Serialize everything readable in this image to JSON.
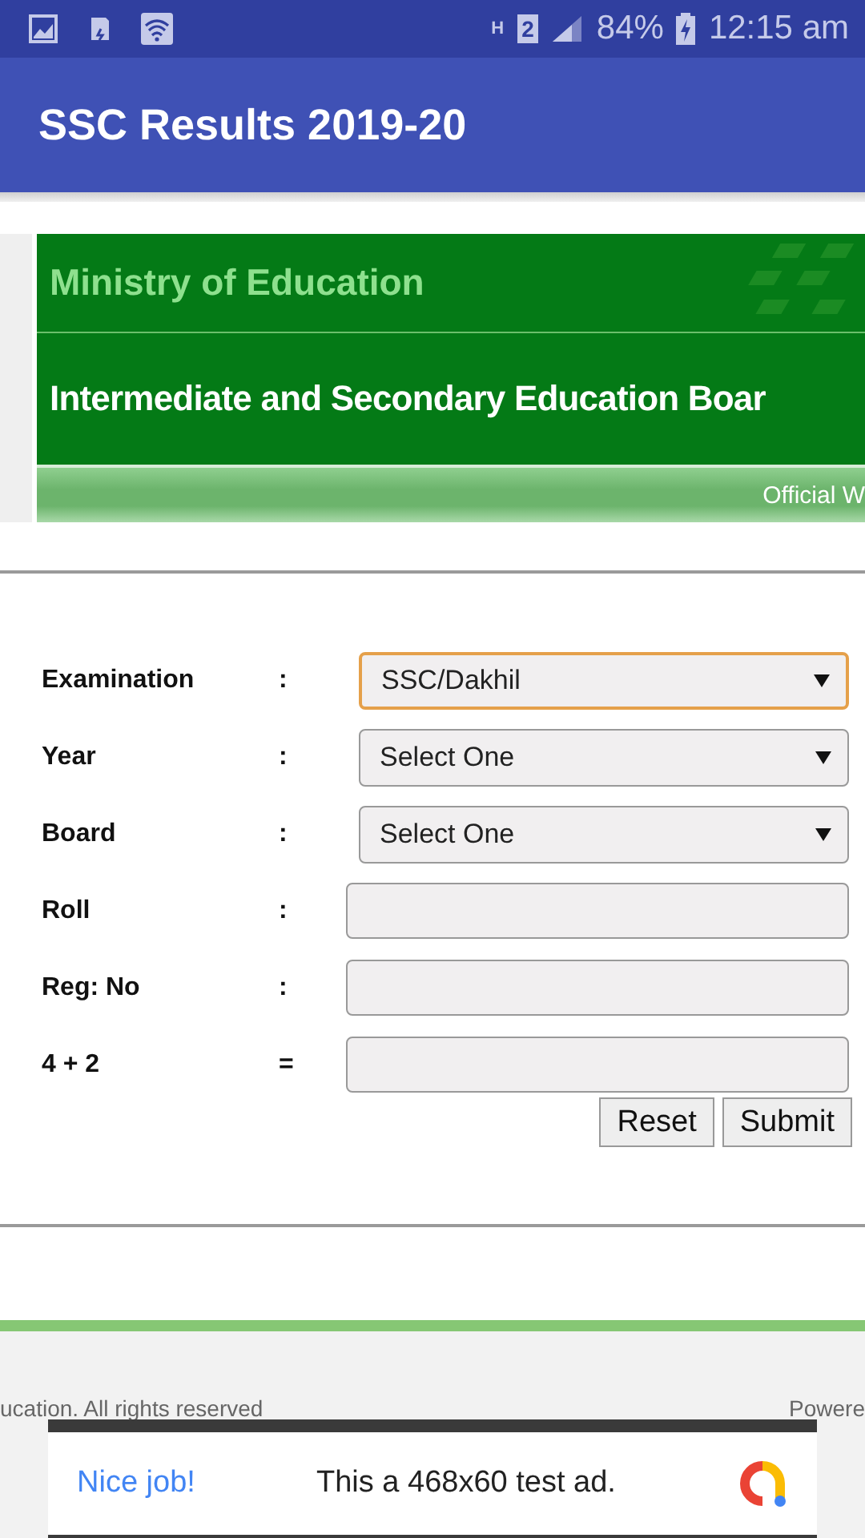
{
  "status_bar": {
    "network_type": "H",
    "sim_slot": "2",
    "battery": "84%",
    "time": "12:15 am"
  },
  "app_bar": {
    "title": "SSC Results 2019-20"
  },
  "banner": {
    "ministry": "Ministry of Education",
    "board": "Intermediate and Secondary Education Boar",
    "ribbon": "Official W"
  },
  "form": {
    "fields": [
      {
        "label": "Examination",
        "separator": ":",
        "kind": "select",
        "value": "SSC/Dakhil",
        "focused": true
      },
      {
        "label": "Year",
        "separator": ":",
        "kind": "select",
        "value": "Select One",
        "focused": false
      },
      {
        "label": "Board",
        "separator": ":",
        "kind": "select",
        "value": "Select One",
        "focused": false
      },
      {
        "label": "Roll",
        "separator": ":",
        "kind": "input",
        "focused": false
      },
      {
        "label": "Reg: No",
        "separator": ":",
        "kind": "input",
        "focused": false
      },
      {
        "label": "4 + 2",
        "separator": "=",
        "kind": "input",
        "focused": false
      }
    ],
    "buttons": [
      "Reset",
      "Submit"
    ]
  },
  "footer": {
    "left": "ucation. All rights reserved",
    "right": "Powere"
  },
  "ad": {
    "headline": "Nice job!",
    "text": "This a 468x60 test ad."
  }
}
